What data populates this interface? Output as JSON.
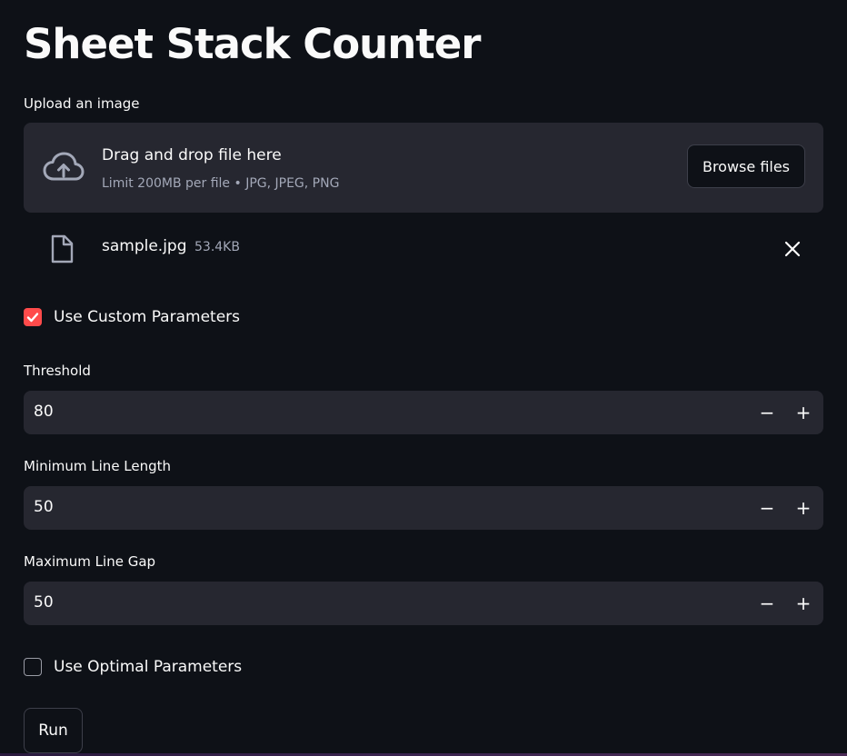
{
  "app": {
    "title": "Sheet Stack Counter"
  },
  "uploader": {
    "label": "Upload an image",
    "drop_title": "Drag and drop file here",
    "drop_subtitle": "Limit 200MB per file • JPG, JPEG, PNG",
    "browse_label": "Browse files",
    "icon": "cloud-upload-icon"
  },
  "uploaded_file": {
    "name": "sample.jpg",
    "size": "53.4KB",
    "icon": "file-icon",
    "remove_icon": "close-icon"
  },
  "custom_params": {
    "label": "Use Custom Parameters",
    "checked": true,
    "check_color": "#ff4b4b"
  },
  "threshold": {
    "label": "Threshold",
    "value": "80",
    "minus": "−",
    "plus": "+"
  },
  "min_line_length": {
    "label": "Minimum Line Length",
    "value": "50",
    "minus": "−",
    "plus": "+"
  },
  "max_line_gap": {
    "label": "Maximum Line Gap",
    "value": "50",
    "minus": "−",
    "plus": "+"
  },
  "optimal_params": {
    "label": "Use Optimal Parameters",
    "checked": false
  },
  "run_button": {
    "label": "Run"
  },
  "colors": {
    "background": "#0e1117",
    "surface": "#262730",
    "accent": "#ff4b4b",
    "text": "#fafafa",
    "muted": "#a3a8b8"
  }
}
